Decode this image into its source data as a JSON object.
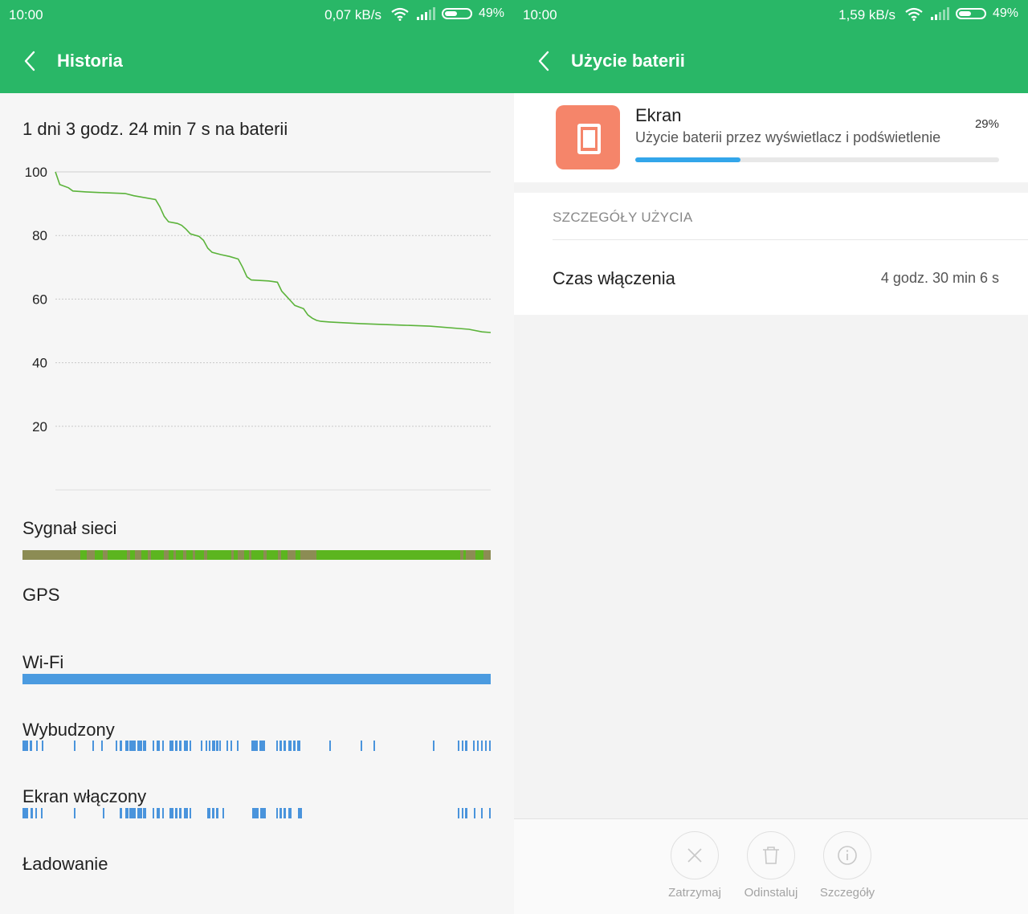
{
  "left": {
    "status_bar": {
      "time": "10:00",
      "speed": "0,07 kB/s",
      "battery": "49%"
    },
    "title": "Historia",
    "duration": "1 dni 3 godz. 24 min 7 s na baterii",
    "chart_data": {
      "type": "line",
      "y_ticks": [
        "100",
        "80",
        "60",
        "40",
        "20"
      ],
      "ylim": [
        0,
        100
      ],
      "xlim": [
        0,
        100
      ],
      "grid": true,
      "series": [
        {
          "color": "#5bb33a",
          "points": [
            [
              0,
              100
            ],
            [
              1,
              96
            ],
            [
              3,
              95
            ],
            [
              4,
              94
            ],
            [
              7,
              93.7
            ],
            [
              10,
              93.5
            ],
            [
              16,
              93.2
            ],
            [
              18,
              92.5
            ],
            [
              23,
              91.3
            ],
            [
              24,
              89
            ],
            [
              25,
              86
            ],
            [
              26,
              84.3
            ],
            [
              28,
              83.8
            ],
            [
              29,
              83.2
            ],
            [
              30,
              82
            ],
            [
              31,
              80.5
            ],
            [
              33,
              79.7
            ],
            [
              34,
              78.5
            ],
            [
              35,
              76
            ],
            [
              36,
              74.7
            ],
            [
              38,
              74
            ],
            [
              40,
              73.4
            ],
            [
              42,
              72.6
            ],
            [
              43,
              70
            ],
            [
              44,
              67
            ],
            [
              45,
              66
            ],
            [
              49,
              65.7
            ],
            [
              50,
              65.5
            ],
            [
              51,
              65.3
            ],
            [
              52,
              62.5
            ],
            [
              53,
              61
            ],
            [
              54,
              59.5
            ],
            [
              55,
              58
            ],
            [
              57,
              57
            ],
            [
              58,
              55
            ],
            [
              59,
              54
            ],
            [
              60,
              53.3
            ],
            [
              61,
              53
            ],
            [
              63,
              52.8
            ],
            [
              70,
              52.3
            ],
            [
              80,
              51.8
            ],
            [
              86,
              51.5
            ],
            [
              95,
              50.5
            ],
            [
              98,
              49.7
            ],
            [
              100,
              49.5
            ]
          ]
        }
      ]
    },
    "sections": {
      "signal": "Sygnał sieci",
      "gps": "GPS",
      "wifi": "Wi-Fi",
      "awake": "Wybudzony",
      "screen_on": "Ekran włączony",
      "charging": "Ładowanie"
    },
    "colors": {
      "signal_good": "#5cb51f",
      "signal_weak": "#8c8c54",
      "wifi": "#4b9be0",
      "awake": "#4a94dc"
    }
  },
  "right": {
    "status_bar": {
      "time": "10:00",
      "speed": "1,59 kB/s",
      "battery": "49%"
    },
    "title": "Użycie baterii",
    "app": {
      "name": "Ekran",
      "description": "Użycie baterii przez wyświetlacz i podświetlenie",
      "percent_label": "29%",
      "percent": 29,
      "icon": "phone-screen-icon"
    },
    "details_header": "SZCZEGÓŁY UŻYCIA",
    "details_row": {
      "label": "Czas włączenia",
      "value": "4 godz. 30 min 6 s"
    },
    "actions": [
      {
        "label": "Zatrzymaj",
        "icon": "close-icon"
      },
      {
        "label": "Odinstaluj",
        "icon": "trash-icon"
      },
      {
        "label": "Szczegóły",
        "icon": "info-icon"
      }
    ]
  }
}
